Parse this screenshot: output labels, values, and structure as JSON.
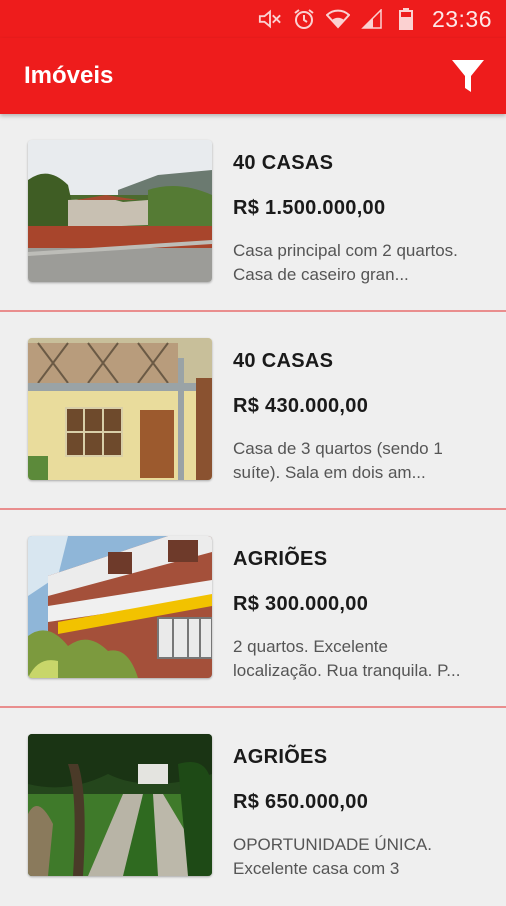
{
  "status_bar": {
    "time": "23:36",
    "icons": [
      "mute-icon",
      "alarm-icon",
      "wifi-icon",
      "signal-icon",
      "battery-icon"
    ]
  },
  "app_bar": {
    "title": "Imóveis",
    "filter_icon": "filter-icon"
  },
  "colors": {
    "primary": "#ee1c1c",
    "divider": "#e98e8e",
    "background": "#efefef"
  },
  "listings": [
    {
      "name": "40 CASAS",
      "price": "R$ 1.500.000,00",
      "description": "Casa principal com 2 quartos.\nCasa de caseiro gran...",
      "photo": "house-with-brick-wall-photo"
    },
    {
      "name": "40 CASAS",
      "price": "R$ 430.000,00",
      "description": "Casa de 3 quartos (sendo 1\nsuíte). Sala em dois am...",
      "photo": "yellow-house-balcony-photo"
    },
    {
      "name": "AGRIÕES",
      "price": "R$ 300.000,00",
      "description": "2 quartos. Excelente\nlocalização. Rua tranquila. P...",
      "photo": "townhouse-awning-photo"
    },
    {
      "name": "AGRIÕES",
      "price": "R$ 650.000,00",
      "description": "OPORTUNIDADE ÚNICA.\nExcelente casa com 3",
      "photo": "garden-path-photo"
    }
  ]
}
